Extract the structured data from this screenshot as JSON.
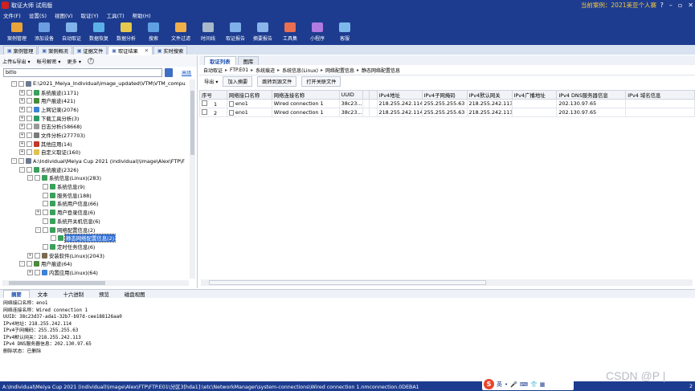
{
  "window": {
    "title": "取证大师 试用版",
    "current_case": "当前案例：2021美亚个人赛",
    "buttons": [
      "?",
      "–",
      "▫",
      "✕"
    ]
  },
  "menu": [
    "文件(F)",
    "设置(S)",
    "视图(V)",
    "取证(Y)",
    "工具(T)",
    "帮助(H)"
  ],
  "toolbar": [
    {
      "label": "案例管理",
      "color": "#e8a33a"
    },
    {
      "label": "添加设备",
      "color": "#6a9ee0"
    },
    {
      "label": "自动取证",
      "color": "#7fb3ea"
    },
    {
      "label": "数据恢复",
      "color": "#5cb0e8"
    },
    {
      "label": "数据分析",
      "color": "#e6c84e"
    },
    {
      "label": "搜索",
      "color": "#5fa0e2"
    },
    {
      "label": "文件过滤",
      "color": "#f0b04a"
    },
    {
      "label": "时间线",
      "color": "#aab8cc"
    },
    {
      "label": "取证报告",
      "color": "#7fb0e8"
    },
    {
      "label": "摘要报告",
      "color": "#88b4ea"
    },
    {
      "label": "工具集",
      "color": "#e86f52"
    },
    {
      "label": "小程序",
      "color": "#b07ae0"
    },
    {
      "label": "客服",
      "color": "#7cb8ea"
    }
  ],
  "tabs": [
    {
      "label": "案例管理",
      "active": false,
      "closable": false
    },
    {
      "label": "案例概况",
      "active": false,
      "closable": false
    },
    {
      "label": "证据文件",
      "active": false,
      "closable": false
    },
    {
      "label": "取证结果",
      "active": true,
      "closable": true
    },
    {
      "label": "实时搜索",
      "active": false,
      "closable": false
    }
  ],
  "left": {
    "toolbar": [
      "上传&导出 ▾",
      "帐号解密 ▾",
      "更多 ▾",
      "?"
    ],
    "search_value": "bitlo",
    "advanced": "高级"
  },
  "tree": [
    {
      "label": "E:\\2021_Meiya_Individual\\image_updated\\VTM\\VTM_compu",
      "indent": 0,
      "exp": "-",
      "color": "#6b7a90"
    },
    {
      "label": "系统痕迹(1171)",
      "indent": 1,
      "exp": "+",
      "color": "#3aa05a"
    },
    {
      "label": "用户痕迹(421)",
      "indent": 1,
      "exp": "+",
      "color": "#4a8a3c"
    },
    {
      "label": "上网记录(2076)",
      "indent": 1,
      "exp": "+",
      "color": "#3b82d6"
    },
    {
      "label": "下载工具分析(3)",
      "indent": 1,
      "exp": "+",
      "color": "#2c9a66"
    },
    {
      "label": "日志分析(58668)",
      "indent": 1,
      "exp": "+",
      "color": "#999999"
    },
    {
      "label": "文件分析(277703)",
      "indent": 1,
      "exp": "+",
      "color": "#7a7a7a"
    },
    {
      "label": "其他应用(14)",
      "indent": 1,
      "exp": "+",
      "color": "#c0392b"
    },
    {
      "label": "自定义取证(160)",
      "indent": 1,
      "exp": "+",
      "color": "#e0c050"
    },
    {
      "label": "A:\\Individual\\Meiya Cup 2021 (individual)\\image\\Alex\\FTP\\F",
      "indent": 0,
      "exp": "-",
      "color": "#6b7a90"
    },
    {
      "label": "系统痕迹(2326)",
      "indent": 1,
      "exp": "-",
      "color": "#3aa05a"
    },
    {
      "label": "系统信息(Linux)(283)",
      "indent": 2,
      "exp": "-",
      "color": "#3aa05a"
    },
    {
      "label": "系统信息(9)",
      "indent": 3,
      "exp": "",
      "color": "#3aa05a"
    },
    {
      "label": "服务信息(188)",
      "indent": 3,
      "exp": "",
      "color": "#3aa05a"
    },
    {
      "label": "系统用户信息(66)",
      "indent": 3,
      "exp": "",
      "color": "#3aa05a"
    },
    {
      "label": "用户登录信息(6)",
      "indent": 3,
      "exp": "+",
      "color": "#3aa05a"
    },
    {
      "label": "系统开关机信息(6)",
      "indent": 3,
      "exp": "",
      "color": "#3aa05a"
    },
    {
      "label": "网络配置信息(2)",
      "indent": 3,
      "exp": "-",
      "color": "#3aa05a"
    },
    {
      "label": "静态网络配置信息(2)",
      "indent": 4,
      "exp": "",
      "color": "#3aa05a",
      "selected": true
    },
    {
      "label": "定时任务信息(6)",
      "indent": 3,
      "exp": "",
      "color": "#3aa05a"
    },
    {
      "label": "安装软件(Linux)(2043)",
      "indent": 2,
      "exp": "+",
      "color": "#7a6a50"
    },
    {
      "label": "用户痕迹(64)",
      "indent": 1,
      "exp": "-",
      "color": "#4a8a3c"
    },
    {
      "label": "内置应用(Linux)(64)",
      "indent": 2,
      "exp": "+",
      "color": "#3b82d6"
    }
  ],
  "right": {
    "tabs": [
      {
        "label": "取证列表",
        "active": true
      },
      {
        "label": "图库",
        "active": false
      }
    ],
    "breadcrumb": [
      "自动取证",
      "FTP.E01",
      "系统痕迹",
      "系统信息(Linux)",
      "网络配置信息",
      "静态网络配置信息"
    ],
    "actions": [
      "导出 ▾",
      "加入摘要",
      "跳转到源文件",
      "打开关联文件"
    ],
    "columns": [
      {
        "label": "序号",
        "w": 34
      },
      {
        "label": "网络接口名称",
        "w": 56
      },
      {
        "label": "网络连接名称",
        "w": 84
      },
      {
        "label": "UUID",
        "w": 29
      },
      {
        "label": "",
        "w": 8
      },
      {
        "label": "",
        "w": 10
      },
      {
        "label": "IPv4地址",
        "w": 56
      },
      {
        "label": "IPv4子网掩码",
        "w": 56
      },
      {
        "label": "IPv4默认网关",
        "w": 56
      },
      {
        "label": "IPv4广播地址",
        "w": 56
      },
      {
        "label": "IPv4 DNS服务器信息",
        "w": 86
      },
      {
        "label": "IPv4 域名信息",
        "w": 86
      }
    ],
    "rows": [
      [
        "1",
        "eno1",
        "Wired connection 1",
        "38c23...",
        "",
        "",
        "218.255.242.114",
        "255.255.255.63",
        "218.255.242.113",
        "",
        "202.130.97.65",
        ""
      ],
      [
        "2",
        "eno1",
        "Wired connection 1",
        "38c23...",
        "",
        "",
        "218.255.242.114",
        "255.255.255.63",
        "218.255.242.113",
        "",
        "202.130.97.65",
        ""
      ]
    ]
  },
  "bottom_tabs": [
    {
      "label": "摘要",
      "active": true
    },
    {
      "label": "文本",
      "active": false
    },
    {
      "label": "十六进制",
      "active": false
    },
    {
      "label": "预览",
      "active": false
    },
    {
      "label": "磁盘视图",
      "active": false
    }
  ],
  "detail_lines": [
    "网络接口名称：eno1",
    "网络连接名称：Wired connection 1",
    "UUID：38c23d37-ada1-32b7-b97d-cee188126aa0",
    "IPv4地址：218.255.242.114",
    "IPv4子网掩码：255.255.255.63",
    "IPv4默认网关：218.255.242.113",
    "IPv4 DNS服务器信息：202.130.97.65",
    "删除状态：已删除"
  ],
  "status": {
    "path": "A:\\Individual\\Meiya Cup 2021 (individual)\\image\\Alex\\FTP\\FTP.E01\\分区3[hda1]:\\etc\\NetworkManager\\system-connections\\Wired connection 1.nmconnection.0DEBA1",
    "records": "2",
    "ime_lang": "英"
  },
  "watermark": "CSDN @P | "
}
